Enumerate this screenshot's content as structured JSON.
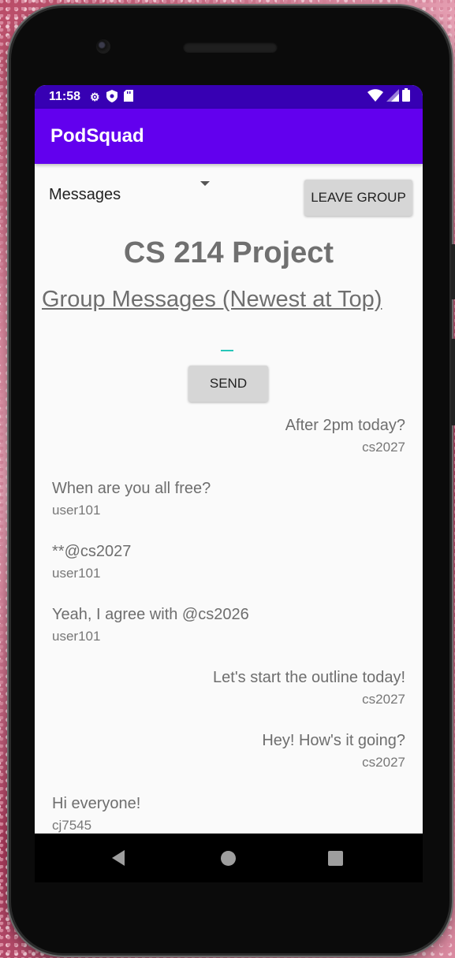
{
  "status_bar": {
    "time": "11:58",
    "icons_left": [
      "gear-icon",
      "shield-icon",
      "sd-card-icon"
    ],
    "icons_right": [
      "wifi-icon",
      "signal-icon",
      "battery-icon"
    ]
  },
  "app_bar": {
    "title": "PodSquad"
  },
  "spinner": {
    "selected": "Messages"
  },
  "leave_button": {
    "label": "LEAVE GROUP"
  },
  "page": {
    "title": "CS 214 Project",
    "subtitle": "Group Messages (Newest at Top)"
  },
  "send_button": {
    "label": "SEND"
  },
  "messages": [
    {
      "text": "After 2pm today?",
      "user": "cs2027",
      "align": "right"
    },
    {
      "text": "When are you all free?",
      "user": "user101",
      "align": "left"
    },
    {
      "text": "**@cs2027",
      "user": "user101",
      "align": "left"
    },
    {
      "text": "Yeah, I agree with @cs2026",
      "user": "user101",
      "align": "left"
    },
    {
      "text": "Let's start the outline today!",
      "user": "cs2027",
      "align": "right"
    },
    {
      "text": "Hey! How's it going?",
      "user": "cs2027",
      "align": "right"
    },
    {
      "text": "Hi everyone!",
      "user": "cj7545",
      "align": "left"
    }
  ],
  "colors": {
    "status_bar": "#3700b3",
    "app_bar": "#6200ee",
    "cursor": "#26c6b8"
  }
}
